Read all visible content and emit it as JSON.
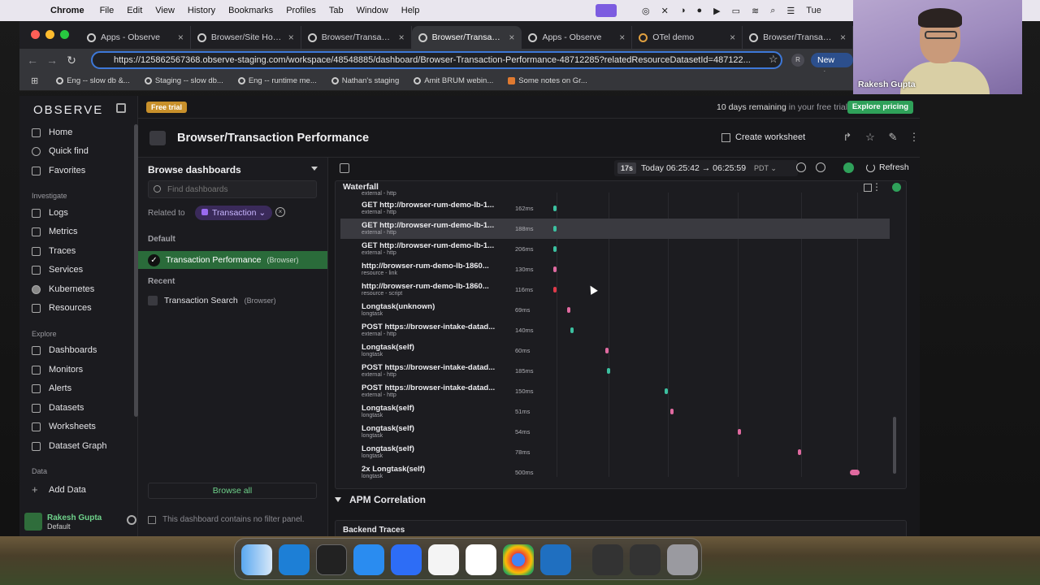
{
  "menubar": {
    "apple": "",
    "app": "Chrome",
    "items": [
      "File",
      "Edit",
      "View",
      "History",
      "Bookmarks",
      "Profiles",
      "Tab",
      "Window",
      "Help"
    ],
    "clock": "Tue"
  },
  "tabs": [
    {
      "label": "Apps - Observe",
      "active": false
    },
    {
      "label": "Browser/Site Home",
      "active": false
    },
    {
      "label": "Browser/Transactio",
      "active": false
    },
    {
      "label": "Browser/Transactio",
      "active": true
    },
    {
      "label": "Apps - Observe",
      "active": false
    },
    {
      "label": "OTel demo",
      "active": false
    },
    {
      "label": "Browser/Transactio",
      "active": false
    }
  ],
  "address": {
    "url": "https://125862567368.observe-staging.com/workspace/48548885/dashboard/Browser-Transaction-Performance-48712285?relatedResourceDatasetId=487122...",
    "profile_initial": "R",
    "new_chrome": "New Chro"
  },
  "bookmarks": [
    "Eng -- slow db &...",
    "Staging -- slow db...",
    "Eng -- runtime me...",
    "Nathan's staging",
    "Amit BRUM webin...",
    "Some notes on Gr..."
  ],
  "nav": {
    "logo": "OBSERVE",
    "primary": [
      "Home",
      "Quick find",
      "Favorites"
    ],
    "investigate_label": "Investigate",
    "investigate": [
      "Logs",
      "Metrics",
      "Traces",
      "Services",
      "Kubernetes",
      "Resources"
    ],
    "explore_label": "Explore",
    "explore": [
      "Dashboards",
      "Monitors",
      "Alerts",
      "Datasets",
      "Worksheets",
      "Dataset Graph"
    ],
    "data_label": "Data",
    "data": [
      "Add Data"
    ],
    "user_name": "Rakesh Gupta",
    "user_sub": "Default"
  },
  "trial": {
    "badge": "Free trial",
    "remaining_bold": "10 days remaining",
    "remaining_rest": " in your free trial",
    "cta": "Explore pricing"
  },
  "header": {
    "title": "Browser/Transaction Performance",
    "create_worksheet": "Create worksheet"
  },
  "browse": {
    "title": "Browse dashboards",
    "search_placeholder": "Find dashboards",
    "related_label": "Related to",
    "related_value": "Transaction",
    "default_label": "Default",
    "active_item": "Transaction Performance",
    "active_item_sub": "(Browser)",
    "recent_label": "Recent",
    "recent_item": "Transaction Search",
    "recent_item_sub": "(Browser)",
    "browse_all": "Browse all",
    "no_filter": "This dashboard contains no filter panel."
  },
  "toolbar": {
    "refresh_interval": "17s",
    "range": "Today 06:25:42 → 06:25:59",
    "tz": "PDT",
    "refresh": "Refresh"
  },
  "waterfall": {
    "title": "Waterfall",
    "first_tail_type": "external - http",
    "rows": [
      {
        "name": "GET http://browser-rum-demo-lb-1...",
        "type": "external - http",
        "duration": "162ms",
        "pos": 0.05,
        "color": "#3cc0a0"
      },
      {
        "name": "GET http://browser-rum-demo-lb-1...",
        "type": "external - http",
        "duration": "188ms",
        "pos": 0.05,
        "color": "#3cc0a0"
      },
      {
        "name": "GET http://browser-rum-demo-lb-1...",
        "type": "external - http",
        "duration": "206ms",
        "pos": 0.05,
        "color": "#3cc0a0"
      },
      {
        "name": "http://browser-rum-demo-lb-1860...",
        "type": "resource - link",
        "duration": "130ms",
        "pos": 0.05,
        "color": "#e06aa0"
      },
      {
        "name": "http://browser-rum-demo-lb-1860...",
        "type": "resource - script",
        "duration": "116ms",
        "pos": 0.05,
        "color": "#e03a4a"
      },
      {
        "name": "Longtask(unknown)",
        "type": "longtask",
        "duration": "69ms",
        "pos": 0.09,
        "color": "#e06aa0"
      },
      {
        "name": "POST https://browser-intake-datad...",
        "type": "external - http",
        "duration": "140ms",
        "pos": 0.1,
        "color": "#3cc0a0"
      },
      {
        "name": "Longtask(self)",
        "type": "longtask",
        "duration": "60ms",
        "pos": 0.2,
        "color": "#e06aa0"
      },
      {
        "name": "POST https://browser-intake-datad...",
        "type": "external - http",
        "duration": "185ms",
        "pos": 0.205,
        "color": "#3cc0a0"
      },
      {
        "name": "POST https://browser-intake-datad...",
        "type": "external - http",
        "duration": "150ms",
        "pos": 0.37,
        "color": "#3cc0a0"
      },
      {
        "name": "Longtask(self)",
        "type": "longtask",
        "duration": "51ms",
        "pos": 0.385,
        "color": "#e06aa0"
      },
      {
        "name": "Longtask(self)",
        "type": "longtask",
        "duration": "54ms",
        "pos": 0.58,
        "color": "#e06aa0"
      },
      {
        "name": "Longtask(self)",
        "type": "longtask",
        "duration": "78ms",
        "pos": 0.75,
        "color": "#e06aa0"
      },
      {
        "name": "2x Longtask(self)",
        "type": "longtask",
        "duration": "500ms",
        "pos": 0.9,
        "color": "#e06aa0"
      }
    ]
  },
  "sections": {
    "apm": "APM Correlation",
    "backend": "Backend Traces"
  },
  "webcam": {
    "name": "Rakesh Gupta"
  },
  "colors": {
    "accent": "#2fa15a",
    "highlight": "#2a6b3a",
    "chip": "#3a2a5a"
  }
}
